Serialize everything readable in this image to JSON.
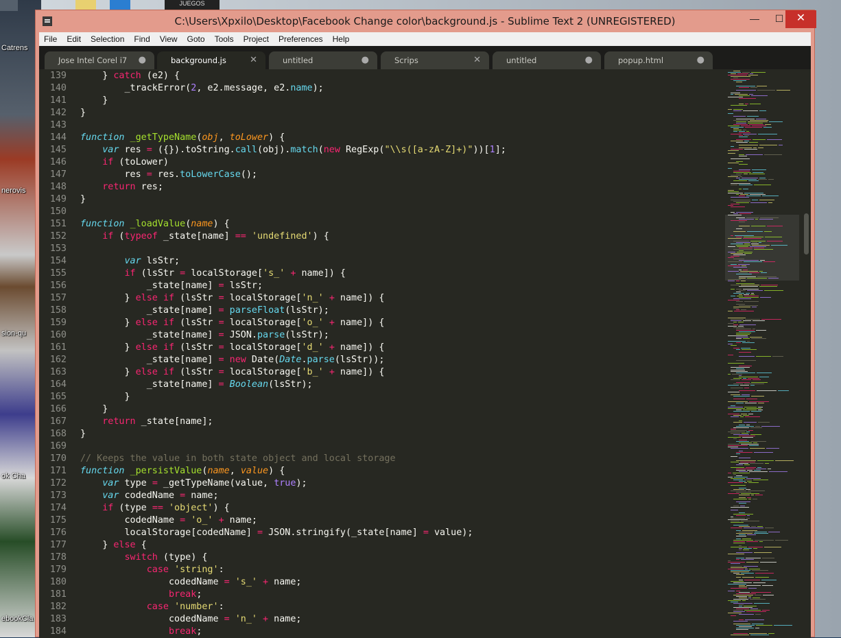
{
  "window": {
    "title": "C:\\Users\\Xpxilo\\Desktop\\Facebook Change color\\background.js - Sublime Text 2 (UNREGISTERED)",
    "minimize": "—",
    "maximize": "☐",
    "close": "✕"
  },
  "desktop": {
    "icons": [
      "Catrens",
      "nerovis",
      "sion-qu",
      "ok Cha",
      "ebookCla"
    ],
    "thumb_label": "JUEGOS"
  },
  "menu": [
    "File",
    "Edit",
    "Selection",
    "Find",
    "View",
    "Goto",
    "Tools",
    "Project",
    "Preferences",
    "Help"
  ],
  "tabs": [
    {
      "label": "Jose Intel Corel i7",
      "mark": "●"
    },
    {
      "label": "background.js",
      "mark": "✕",
      "active": true
    },
    {
      "label": "untitled",
      "mark": "●"
    },
    {
      "label": "Scrips",
      "mark": "✕"
    },
    {
      "label": "untitled",
      "mark": "●"
    },
    {
      "label": "popup.html",
      "mark": "●"
    }
  ],
  "code_lines": [
    {
      "n": "139",
      "t": [
        [
          "    } ",
          ""
        ],
        [
          "catch",
          "k"
        ],
        [
          " (e2) {",
          ""
        ]
      ]
    },
    {
      "n": "140",
      "t": [
        [
          "        _trackError(",
          ""
        ],
        [
          "2",
          "n"
        ],
        [
          ", e2.message, e2.",
          ""
        ],
        [
          "name",
          "sb"
        ],
        [
          ");",
          ""
        ]
      ]
    },
    {
      "n": "141",
      "t": [
        [
          "    }",
          ""
        ]
      ]
    },
    {
      "n": "142",
      "t": [
        [
          "}",
          ""
        ]
      ]
    },
    {
      "n": "143",
      "t": [
        [
          "",
          ""
        ]
      ]
    },
    {
      "n": "144",
      "t": [
        [
          "function",
          "it"
        ],
        [
          " ",
          ""
        ],
        [
          "_getTypeName",
          "f"
        ],
        [
          "(",
          ""
        ],
        [
          "obj",
          "p"
        ],
        [
          ", ",
          ""
        ],
        [
          "toLower",
          "p"
        ],
        [
          ") {",
          ""
        ]
      ]
    },
    {
      "n": "145",
      "t": [
        [
          "    ",
          ""
        ],
        [
          "var",
          "it"
        ],
        [
          " res ",
          ""
        ],
        [
          "=",
          "k"
        ],
        [
          " ({}).toString.",
          ""
        ],
        [
          "call",
          "sb"
        ],
        [
          "(obj).",
          ""
        ],
        [
          "match",
          "sb"
        ],
        [
          "(",
          ""
        ],
        [
          "new",
          "k"
        ],
        [
          " RegExp(",
          ""
        ],
        [
          "\"\\\\s([a-zA-Z]+)\"",
          "s"
        ],
        [
          "))[",
          ""
        ],
        [
          "1",
          "n"
        ],
        [
          "];",
          ""
        ]
      ]
    },
    {
      "n": "146",
      "t": [
        [
          "    ",
          ""
        ],
        [
          "if",
          "k"
        ],
        [
          " (toLower)",
          ""
        ]
      ]
    },
    {
      "n": "147",
      "t": [
        [
          "        res ",
          ""
        ],
        [
          "=",
          "k"
        ],
        [
          " res.",
          ""
        ],
        [
          "toLowerCase",
          "sb"
        ],
        [
          "();",
          ""
        ]
      ]
    },
    {
      "n": "148",
      "t": [
        [
          "    ",
          ""
        ],
        [
          "return",
          "k"
        ],
        [
          " res;",
          ""
        ]
      ]
    },
    {
      "n": "149",
      "t": [
        [
          "}",
          ""
        ]
      ]
    },
    {
      "n": "150",
      "t": [
        [
          "",
          ""
        ]
      ]
    },
    {
      "n": "151",
      "t": [
        [
          "function",
          "it"
        ],
        [
          " ",
          ""
        ],
        [
          "_loadValue",
          "f"
        ],
        [
          "(",
          ""
        ],
        [
          "name",
          "p"
        ],
        [
          ") {",
          ""
        ]
      ]
    },
    {
      "n": "152",
      "t": [
        [
          "    ",
          ""
        ],
        [
          "if",
          "k"
        ],
        [
          " (",
          ""
        ],
        [
          "typeof",
          "k"
        ],
        [
          " _state[name] ",
          ""
        ],
        [
          "==",
          "k"
        ],
        [
          " ",
          ""
        ],
        [
          "'undefined'",
          "s"
        ],
        [
          ") {",
          ""
        ]
      ]
    },
    {
      "n": "153",
      "t": [
        [
          "",
          ""
        ]
      ]
    },
    {
      "n": "154",
      "t": [
        [
          "        ",
          ""
        ],
        [
          "var",
          "it"
        ],
        [
          " lsStr;",
          ""
        ]
      ]
    },
    {
      "n": "155",
      "t": [
        [
          "        ",
          ""
        ],
        [
          "if",
          "k"
        ],
        [
          " (lsStr ",
          ""
        ],
        [
          "=",
          "k"
        ],
        [
          " localStorage[",
          ""
        ],
        [
          "'s_'",
          "s"
        ],
        [
          " ",
          ""
        ],
        [
          "+",
          "k"
        ],
        [
          " name]) {",
          ""
        ]
      ]
    },
    {
      "n": "156",
      "t": [
        [
          "            _state[name] ",
          ""
        ],
        [
          "=",
          "k"
        ],
        [
          " lsStr;",
          ""
        ]
      ]
    },
    {
      "n": "157",
      "t": [
        [
          "        } ",
          ""
        ],
        [
          "else",
          "k"
        ],
        [
          " ",
          ""
        ],
        [
          "if",
          "k"
        ],
        [
          " (lsStr ",
          ""
        ],
        [
          "=",
          "k"
        ],
        [
          " localStorage[",
          ""
        ],
        [
          "'n_'",
          "s"
        ],
        [
          " ",
          ""
        ],
        [
          "+",
          "k"
        ],
        [
          " name]) {",
          ""
        ]
      ]
    },
    {
      "n": "158",
      "t": [
        [
          "            _state[name] ",
          ""
        ],
        [
          "=",
          "k"
        ],
        [
          " ",
          ""
        ],
        [
          "parseFloat",
          "sb"
        ],
        [
          "(lsStr);",
          ""
        ]
      ]
    },
    {
      "n": "159",
      "t": [
        [
          "        } ",
          ""
        ],
        [
          "else",
          "k"
        ],
        [
          " ",
          ""
        ],
        [
          "if",
          "k"
        ],
        [
          " (lsStr ",
          ""
        ],
        [
          "=",
          "k"
        ],
        [
          " localStorage[",
          ""
        ],
        [
          "'o_'",
          "s"
        ],
        [
          " ",
          ""
        ],
        [
          "+",
          "k"
        ],
        [
          " name]) {",
          ""
        ]
      ]
    },
    {
      "n": "160",
      "t": [
        [
          "            _state[name] ",
          ""
        ],
        [
          "=",
          "k"
        ],
        [
          " JSON.",
          ""
        ],
        [
          "parse",
          "sb"
        ],
        [
          "(lsStr);",
          ""
        ]
      ]
    },
    {
      "n": "161",
      "t": [
        [
          "        } ",
          ""
        ],
        [
          "else",
          "k"
        ],
        [
          " ",
          ""
        ],
        [
          "if",
          "k"
        ],
        [
          " (lsStr ",
          ""
        ],
        [
          "=",
          "k"
        ],
        [
          " localStorage[",
          ""
        ],
        [
          "'d_'",
          "s"
        ],
        [
          " ",
          ""
        ],
        [
          "+",
          "k"
        ],
        [
          " name]) {",
          ""
        ]
      ]
    },
    {
      "n": "162",
      "t": [
        [
          "            _state[name] ",
          ""
        ],
        [
          "=",
          "k"
        ],
        [
          " ",
          ""
        ],
        [
          "new",
          "k"
        ],
        [
          " Date(",
          ""
        ],
        [
          "Date",
          "it"
        ],
        [
          ".",
          ""
        ],
        [
          "parse",
          "sb"
        ],
        [
          "(lsStr));",
          ""
        ]
      ]
    },
    {
      "n": "163",
      "t": [
        [
          "        } ",
          ""
        ],
        [
          "else",
          "k"
        ],
        [
          " ",
          ""
        ],
        [
          "if",
          "k"
        ],
        [
          " (lsStr ",
          ""
        ],
        [
          "=",
          "k"
        ],
        [
          " localStorage[",
          ""
        ],
        [
          "'b_'",
          "s"
        ],
        [
          " ",
          ""
        ],
        [
          "+",
          "k"
        ],
        [
          " name]) {",
          ""
        ]
      ]
    },
    {
      "n": "164",
      "t": [
        [
          "            _state[name] ",
          ""
        ],
        [
          "=",
          "k"
        ],
        [
          " ",
          ""
        ],
        [
          "Boolean",
          "it"
        ],
        [
          "(lsStr);",
          ""
        ]
      ]
    },
    {
      "n": "165",
      "t": [
        [
          "        }",
          ""
        ]
      ]
    },
    {
      "n": "166",
      "t": [
        [
          "    }",
          ""
        ]
      ]
    },
    {
      "n": "167",
      "t": [
        [
          "    ",
          ""
        ],
        [
          "return",
          "k"
        ],
        [
          " _state[name];",
          ""
        ]
      ]
    },
    {
      "n": "168",
      "t": [
        [
          "}",
          ""
        ]
      ]
    },
    {
      "n": "169",
      "t": [
        [
          "",
          ""
        ]
      ]
    },
    {
      "n": "170",
      "t": [
        [
          "// Keeps the value in both state object and local storage",
          "c"
        ]
      ]
    },
    {
      "n": "171",
      "t": [
        [
          "function",
          "it"
        ],
        [
          " ",
          ""
        ],
        [
          "_persistValue",
          "f"
        ],
        [
          "(",
          ""
        ],
        [
          "name",
          "p"
        ],
        [
          ", ",
          ""
        ],
        [
          "value",
          "p"
        ],
        [
          ") {",
          ""
        ]
      ]
    },
    {
      "n": "172",
      "t": [
        [
          "    ",
          ""
        ],
        [
          "var",
          "it"
        ],
        [
          " type ",
          ""
        ],
        [
          "=",
          "k"
        ],
        [
          " _getTypeName(value, ",
          ""
        ],
        [
          "true",
          "n"
        ],
        [
          ");",
          ""
        ]
      ]
    },
    {
      "n": "173",
      "t": [
        [
          "    ",
          ""
        ],
        [
          "var",
          "it"
        ],
        [
          " codedName ",
          ""
        ],
        [
          "=",
          "k"
        ],
        [
          " name;",
          ""
        ]
      ]
    },
    {
      "n": "174",
      "t": [
        [
          "    ",
          ""
        ],
        [
          "if",
          "k"
        ],
        [
          " (type ",
          ""
        ],
        [
          "==",
          "k"
        ],
        [
          " ",
          ""
        ],
        [
          "'object'",
          "s"
        ],
        [
          ") {",
          ""
        ]
      ]
    },
    {
      "n": "175",
      "t": [
        [
          "        codedName ",
          ""
        ],
        [
          "=",
          "k"
        ],
        [
          " ",
          ""
        ],
        [
          "'o_'",
          "s"
        ],
        [
          " ",
          ""
        ],
        [
          "+",
          "k"
        ],
        [
          " name;",
          ""
        ]
      ]
    },
    {
      "n": "176",
      "t": [
        [
          "        localStorage[codedName] ",
          ""
        ],
        [
          "=",
          "k"
        ],
        [
          " JSON.stringify(_state[name] ",
          ""
        ],
        [
          "=",
          "k"
        ],
        [
          " value);",
          ""
        ]
      ]
    },
    {
      "n": "177",
      "t": [
        [
          "    } ",
          ""
        ],
        [
          "else",
          "k"
        ],
        [
          " {",
          ""
        ]
      ]
    },
    {
      "n": "178",
      "t": [
        [
          "        ",
          ""
        ],
        [
          "switch",
          "k"
        ],
        [
          " (type) {",
          ""
        ]
      ]
    },
    {
      "n": "179",
      "t": [
        [
          "            ",
          ""
        ],
        [
          "case",
          "k"
        ],
        [
          " ",
          ""
        ],
        [
          "'string'",
          "s"
        ],
        [
          ":",
          ""
        ]
      ]
    },
    {
      "n": "180",
      "t": [
        [
          "                codedName ",
          ""
        ],
        [
          "=",
          "k"
        ],
        [
          " ",
          ""
        ],
        [
          "'s_'",
          "s"
        ],
        [
          " ",
          ""
        ],
        [
          "+",
          "k"
        ],
        [
          " name;",
          ""
        ]
      ]
    },
    {
      "n": "181",
      "t": [
        [
          "                ",
          ""
        ],
        [
          "break",
          "k"
        ],
        [
          ";",
          ""
        ]
      ]
    },
    {
      "n": "182",
      "t": [
        [
          "            ",
          ""
        ],
        [
          "case",
          "k"
        ],
        [
          " ",
          ""
        ],
        [
          "'number'",
          "s"
        ],
        [
          ":",
          ""
        ]
      ]
    },
    {
      "n": "183",
      "t": [
        [
          "                codedName ",
          ""
        ],
        [
          "=",
          "k"
        ],
        [
          " ",
          ""
        ],
        [
          "'n_'",
          "s"
        ],
        [
          " ",
          ""
        ],
        [
          "+",
          "k"
        ],
        [
          " name;",
          ""
        ]
      ]
    },
    {
      "n": "184",
      "t": [
        [
          "                ",
          ""
        ],
        [
          "break",
          "k"
        ],
        [
          ";",
          ""
        ]
      ]
    }
  ]
}
